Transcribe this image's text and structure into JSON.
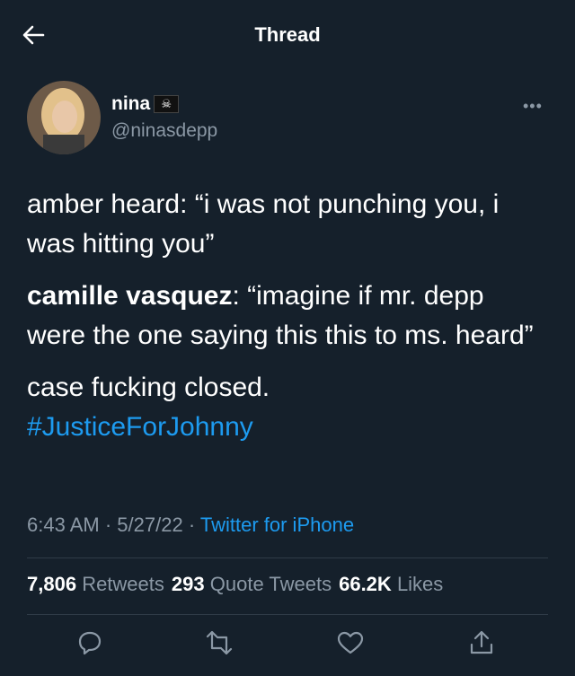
{
  "header": {
    "title": "Thread"
  },
  "author": {
    "name": "nina",
    "handle": "@ninasdepp"
  },
  "tweet": {
    "para1": "amber heard: “i was not punching you, i was hitting you”",
    "para2_bold": "camille vasquez",
    "para2_rest": ": “imagine if mr. depp were the one saying this this to ms. heard”",
    "para3_text": "case fucking closed.",
    "hashtag": "#JusticeForJohnny"
  },
  "meta": {
    "time": "6:43 AM",
    "date": "5/27/22",
    "source": "Twitter for iPhone"
  },
  "stats": {
    "retweets_count": "7,806",
    "retweets_label": "Retweets",
    "quotes_count": "293",
    "quotes_label": "Quote Tweets",
    "likes_count": "66.2K",
    "likes_label": "Likes"
  }
}
